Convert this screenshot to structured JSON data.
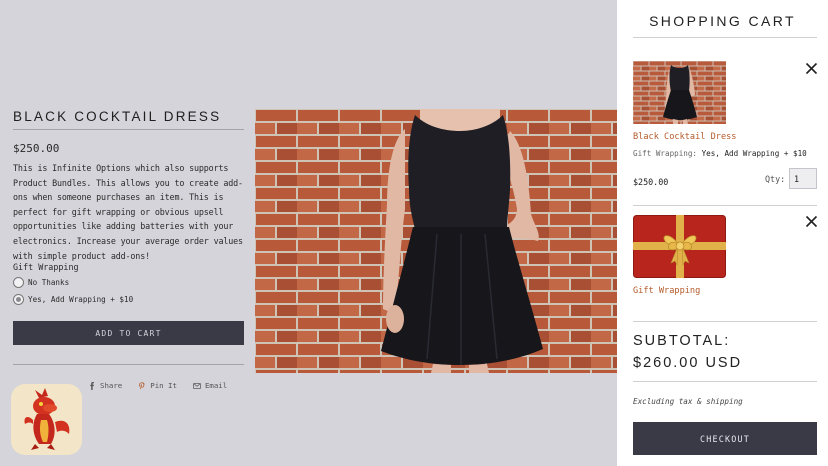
{
  "product": {
    "title": "BLACK COCKTAIL DRESS",
    "price": "$250.00",
    "description": "This is Infinite Options which also supports Product Bundles. This allows you to create add-ons when someone purchases an item. This is perfect for gift wrapping or obvious upsell opportunities like adding batteries with your electronics. Increase your average order values with simple product add-ons!",
    "option_label": "Gift Wrapping",
    "options": [
      {
        "label": "No Thanks",
        "selected": false
      },
      {
        "label": "Yes, Add Wrapping + $10",
        "selected": true
      }
    ],
    "add_to_cart_label": "ADD TO CART",
    "share": [
      {
        "label": "Share",
        "icon": "facebook-icon"
      },
      {
        "label": "Pin It",
        "icon": "pinterest-icon"
      },
      {
        "label": "Email",
        "icon": "email-icon"
      }
    ]
  },
  "cart": {
    "title": "SHOPPING CART",
    "items": [
      {
        "name": "Black Cocktail Dress",
        "option_name": "Gift Wrapping:",
        "option_value": "Yes, Add Wrapping + $10",
        "price": "$250.00",
        "qty_label": "Qty:",
        "qty": "1"
      },
      {
        "name": "Gift Wrapping"
      }
    ],
    "subtotal_label": "SUBTOTAL:",
    "subtotal_value": "$260.00 USD",
    "tax_note": "Excluding tax & shipping",
    "checkout_label": "CHECKOUT"
  },
  "colors": {
    "accent": "#b45a2a",
    "button": "#3a3a46",
    "overlay_bg": "#d4d4da"
  }
}
